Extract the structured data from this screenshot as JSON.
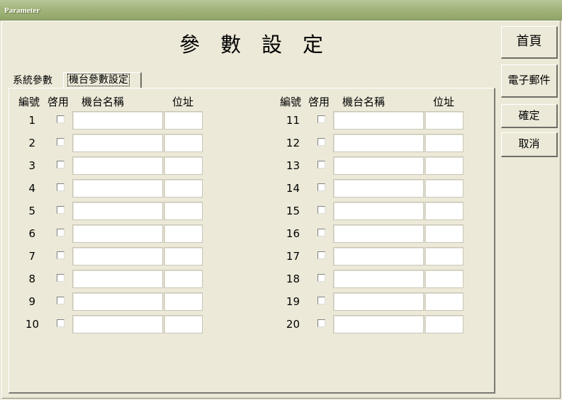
{
  "window": {
    "title": "Parameter"
  },
  "header": {
    "title": "參數設定"
  },
  "tabs": [
    {
      "label": "系統參數"
    },
    {
      "label": "機台參數設定"
    }
  ],
  "columns": {
    "id": "編號",
    "enabled": "啓用",
    "name": "機台名稱",
    "address": "位址"
  },
  "rows": [
    {
      "id": "1"
    },
    {
      "id": "2"
    },
    {
      "id": "3"
    },
    {
      "id": "4"
    },
    {
      "id": "5"
    },
    {
      "id": "6"
    },
    {
      "id": "7"
    },
    {
      "id": "8"
    },
    {
      "id": "9"
    },
    {
      "id": "10"
    },
    {
      "id": "11"
    },
    {
      "id": "12"
    },
    {
      "id": "13"
    },
    {
      "id": "14"
    },
    {
      "id": "15"
    },
    {
      "id": "16"
    },
    {
      "id": "17"
    },
    {
      "id": "18"
    },
    {
      "id": "19"
    },
    {
      "id": "20"
    }
  ],
  "buttons": {
    "home": "首頁",
    "email": "電子郵件",
    "confirm": "確定",
    "cancel": "取消"
  }
}
